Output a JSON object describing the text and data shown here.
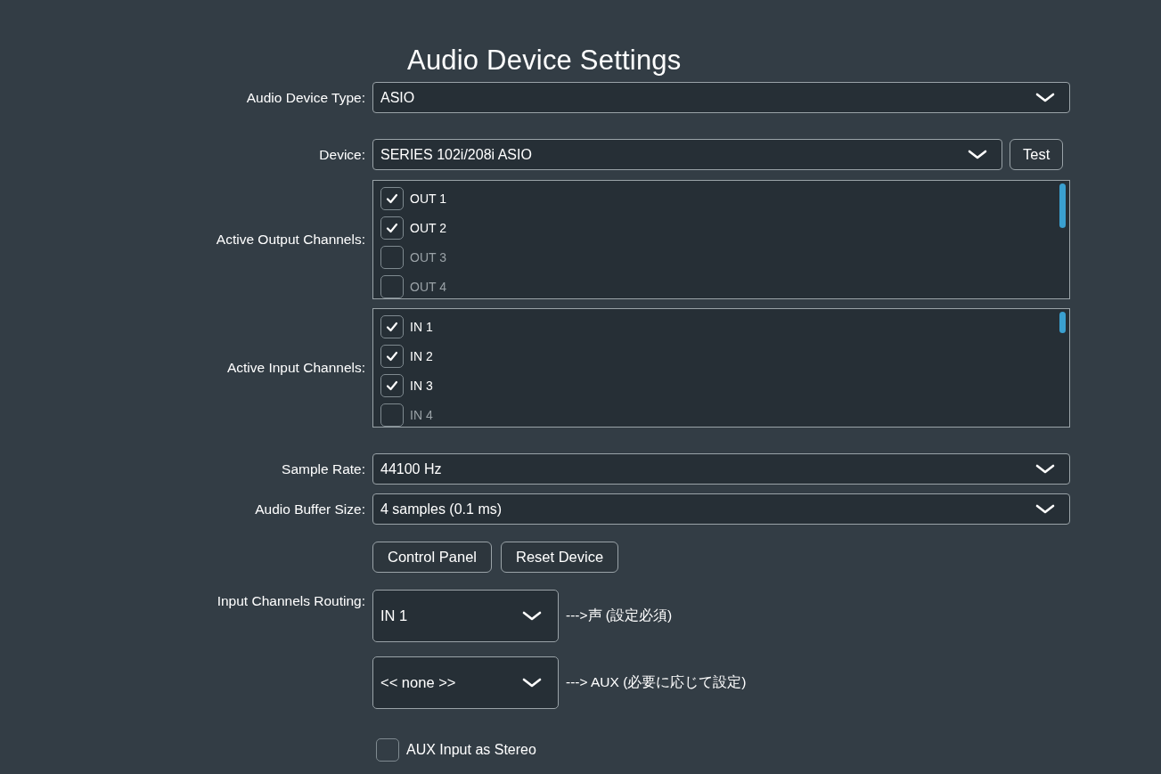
{
  "title": "Audio Device Settings",
  "audio_device_type": {
    "label": "Audio Device Type:",
    "value": "ASIO"
  },
  "device": {
    "label": "Device:",
    "value": "SERIES 102i/208i ASIO",
    "test_button": "Test"
  },
  "output_channels": {
    "label": "Active Output Channels:",
    "items": [
      {
        "name": "OUT 1",
        "checked": true
      },
      {
        "name": "OUT 2",
        "checked": true
      },
      {
        "name": "OUT 3",
        "checked": false
      },
      {
        "name": "OUT 4",
        "checked": false
      }
    ]
  },
  "input_channels": {
    "label": "Active Input Channels:",
    "items": [
      {
        "name": "IN 1",
        "checked": true
      },
      {
        "name": "IN 2",
        "checked": true
      },
      {
        "name": "IN 3",
        "checked": true
      },
      {
        "name": "IN 4",
        "checked": false
      }
    ]
  },
  "sample_rate": {
    "label": "Sample Rate:",
    "value": "44100 Hz"
  },
  "buffer_size": {
    "label": "Audio Buffer Size:",
    "value": "4 samples (0.1 ms)"
  },
  "buttons": [
    "Control Panel",
    "Reset Device"
  ],
  "routing": {
    "label": "Input Channels Routing:",
    "rows": [
      {
        "value": "IN 1",
        "note": "--->声 (設定必須)"
      },
      {
        "value": "<< none >>",
        "note": "---> AUX (必要に応じて設定)"
      }
    ]
  },
  "aux_stereo": {
    "label": "AUX Input as Stereo",
    "checked": false
  }
}
